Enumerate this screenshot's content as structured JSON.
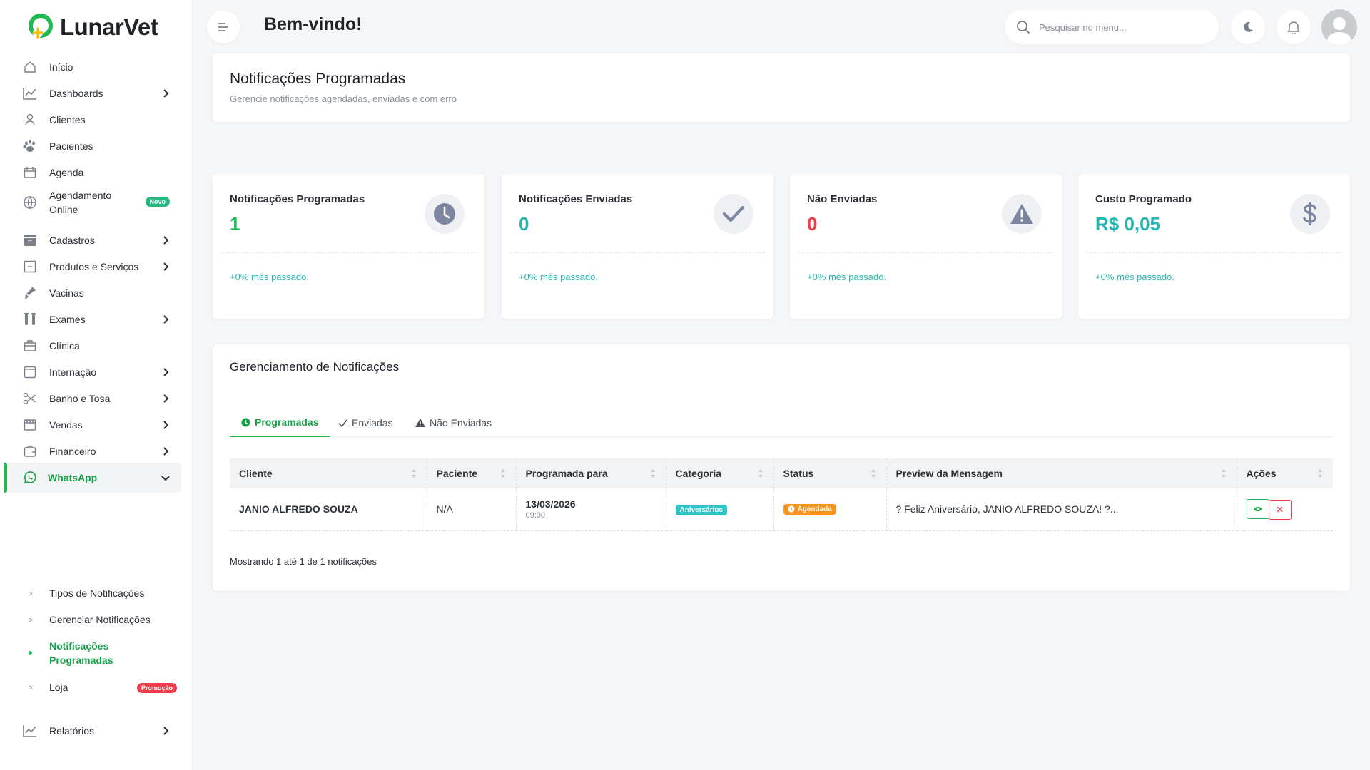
{
  "app": {
    "name": "LunarVet"
  },
  "sidebar": {
    "items": [
      {
        "label": "Início",
        "icon": "home-icon"
      },
      {
        "label": "Dashboards",
        "icon": "chart-line-icon"
      },
      {
        "label": "Clientes",
        "icon": "user-icon"
      },
      {
        "label": "Pacientes",
        "icon": "paw-icon"
      },
      {
        "label": "Agenda",
        "icon": "calendar-icon"
      },
      {
        "label": "Agendamento Online",
        "icon": "globe-icon",
        "badge": "Novo"
      },
      {
        "label": "Cadastros",
        "icon": "archive-icon"
      },
      {
        "label": "Produtos e Serviços",
        "icon": "box-icon"
      },
      {
        "label": "Vacinas",
        "icon": "syringe-icon"
      },
      {
        "label": "Exames",
        "icon": "test-tube-icon"
      },
      {
        "label": "Clínica",
        "icon": "briefcase-icon"
      },
      {
        "label": "Internação",
        "icon": "window-icon"
      },
      {
        "label": "Banho e Tosa",
        "icon": "scissors-icon"
      },
      {
        "label": "Vendas",
        "icon": "store-icon"
      },
      {
        "label": "Financeiro",
        "icon": "wallet-icon"
      },
      {
        "label": "WhatsApp",
        "icon": "whatsapp-icon"
      },
      {
        "label": "Relatórios",
        "icon": "report-icon"
      }
    ],
    "whatsapp_sub": [
      {
        "label": "Tipos de Notificações"
      },
      {
        "label": "Gerenciar Notificações"
      },
      {
        "label": "Notificações Programadas"
      },
      {
        "label": "Loja",
        "badge": "Promoção"
      }
    ]
  },
  "topbar": {
    "welcome": "Bem-vindo!",
    "search_placeholder": "Pesquisar no menu..."
  },
  "page": {
    "title": "Notificações Programadas",
    "subtitle": "Gerencie notificações agendadas, enviadas e com erro"
  },
  "stats": [
    {
      "label": "Notificações Programadas",
      "value": "1",
      "foot": "+0% mês passado.",
      "color": "#1fb954",
      "icon": "clock-icon"
    },
    {
      "label": "Notificações Enviadas",
      "value": "0",
      "foot": "+0% mês passado.",
      "color": "#27b5b0",
      "icon": "check-icon"
    },
    {
      "label": "Não Enviadas",
      "value": "0",
      "foot": "+0% mês passado.",
      "color": "#ef3e4a",
      "icon": "warning-icon"
    },
    {
      "label": "Custo Programado",
      "value": "R$ 0,05",
      "foot": "+0% mês passado.",
      "color": "#27b5b0",
      "icon": "dollar-icon"
    }
  ],
  "management": {
    "title": "Gerenciamento de Notificações",
    "tabs": [
      {
        "label": "Programadas",
        "icon": "clock-icon"
      },
      {
        "label": "Enviadas",
        "icon": "check-icon"
      },
      {
        "label": "Não Enviadas",
        "icon": "warning-icon"
      }
    ],
    "columns": [
      "Cliente",
      "Paciente",
      "Programada para",
      "Categoria",
      "Status",
      "Preview da Mensagem",
      "Ações"
    ],
    "rows": [
      {
        "cliente": "JANIO ALFREDO SOUZA",
        "paciente": "N/A",
        "data": "13/03/2026",
        "hora": "09:00",
        "categoria": "Aniversários",
        "status": "Agendada",
        "preview": "? Feliz Aniversário, JANIO ALFREDO SOUZA! ?..."
      }
    ],
    "showing": "Mostrando 1 até 1 de 1 notificações"
  },
  "colors": {
    "accent": "#1fb954",
    "teal": "#27b5b0",
    "danger": "#ef3e4a",
    "warning": "#f7931e",
    "category": "#2ec4c4"
  }
}
